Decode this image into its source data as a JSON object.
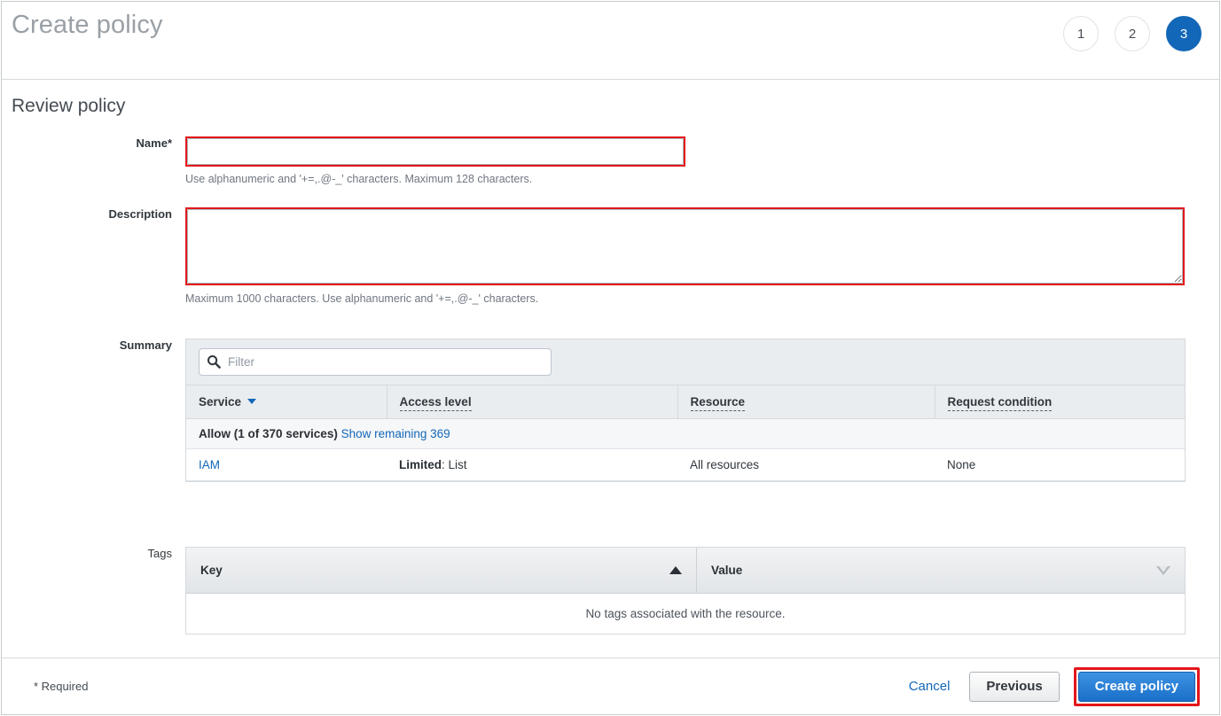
{
  "header": {
    "title": "Create policy",
    "steps": [
      {
        "label": "1",
        "active": false
      },
      {
        "label": "2",
        "active": false
      },
      {
        "label": "3",
        "active": true
      }
    ]
  },
  "section": {
    "title": "Review policy"
  },
  "form": {
    "name": {
      "label": "Name*",
      "value": "",
      "placeholder": "",
      "helper": "Use alphanumeric and '+=,.@-_' characters. Maximum 128 characters."
    },
    "description": {
      "label": "Description",
      "value": "",
      "placeholder": "",
      "helper": "Maximum 1000 characters. Use alphanumeric and '+=,.@-_' characters."
    }
  },
  "summary": {
    "label": "Summary",
    "filter": {
      "placeholder": "Filter",
      "value": "",
      "icon": "search-icon"
    },
    "columns": [
      {
        "label": "Service",
        "sort": "desc",
        "tooltip": false
      },
      {
        "label": "Access level",
        "sort": null,
        "tooltip": true
      },
      {
        "label": "Resource",
        "sort": null,
        "tooltip": true
      },
      {
        "label": "Request condition",
        "sort": null,
        "tooltip": true
      }
    ],
    "group": {
      "effect": "Allow (1 of 370 services)",
      "show_remaining": "Show remaining 369"
    },
    "rows": [
      {
        "service": "IAM",
        "access_level_prefix": "Limited",
        "access_level_suffix": ": List",
        "resource": "All resources",
        "request_condition": "None"
      }
    ]
  },
  "tags": {
    "label": "Tags",
    "columns": [
      {
        "label": "Key",
        "sort": "asc"
      },
      {
        "label": "Value",
        "sort": null
      }
    ],
    "empty_message": "No tags associated with the resource."
  },
  "footer": {
    "required_note": "* Required",
    "cancel_label": "Cancel",
    "previous_label": "Previous",
    "create_label": "Create policy"
  },
  "colors": {
    "accent_blue": "#1267b8",
    "link_blue": "#1267b8",
    "highlight_red": "#e4161a",
    "primary_button": "#1a6fc9"
  }
}
